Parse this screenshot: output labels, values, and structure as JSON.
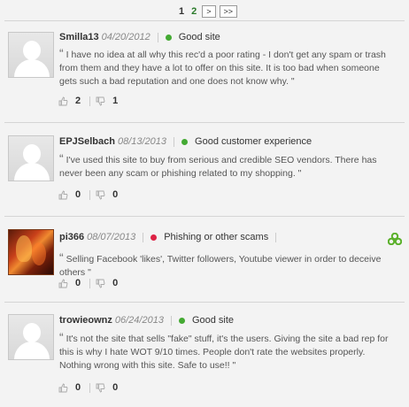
{
  "pagination": {
    "page1": "1",
    "page2": "2",
    "next": ">",
    "last": ">>"
  },
  "colors": {
    "good": "#44aa33",
    "bad": "#dd2244"
  },
  "reviews": [
    {
      "author": "Smilla13",
      "date": "04/20/2012",
      "category": "Good site",
      "rating_color": "good",
      "text": "I have no idea at all why this rec'd a poor rating - I don't get any spam or trash from them and they have a lot to offer on this site. It is too bad when someone gets such a bad reputation and one does not know why. \"",
      "up": "2",
      "down": "1"
    },
    {
      "author": "EPJSelbach",
      "date": "08/13/2013",
      "category": "Good customer experience",
      "rating_color": "good",
      "text": "I've used this site to buy from serious and credible SEO vendors. There has never been any scam or phishing related to my shopping. \"",
      "up": "0",
      "down": "0"
    },
    {
      "author": "pi366",
      "date": "08/07/2013",
      "category": "Phishing or other scams",
      "rating_color": "bad",
      "text": "Selling Facebook 'likes', Twitter followers, Youtube viewer in order to deceive others \"",
      "up": "0",
      "down": "0",
      "icon": "share-icon"
    },
    {
      "author": "trowieownz",
      "date": "06/24/2013",
      "category": "Good site",
      "rating_color": "good",
      "text": "It's not the site that sells \"fake\" stuff, it's the users. Giving the site a bad rep for this is why I hate WOT 9/10 times. People don't rate the websites properly. Nothing wrong with this site. Safe to use!! \"",
      "up": "0",
      "down": "0"
    }
  ]
}
